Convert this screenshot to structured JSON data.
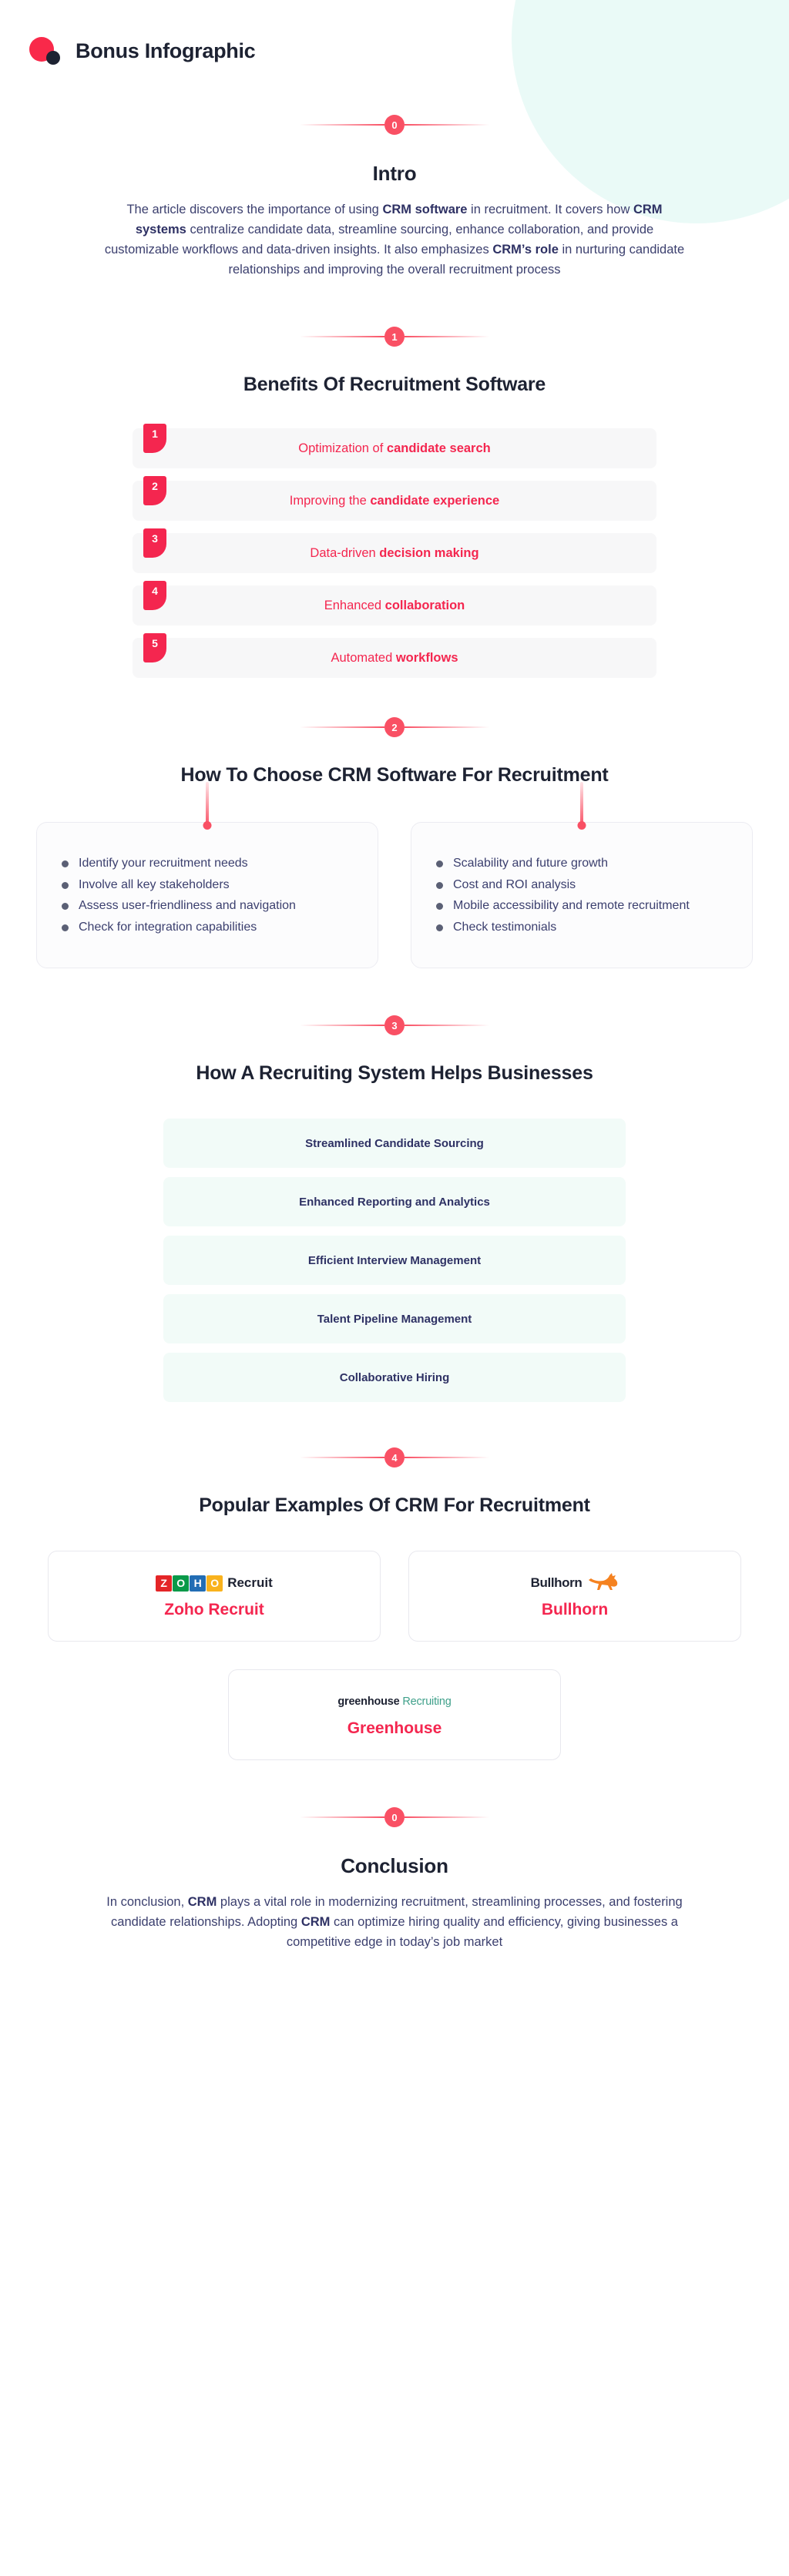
{
  "header": {
    "title": "Bonus Infographic",
    "logo_primary_color": "#f9294a",
    "logo_secondary_color": "#1d2232"
  },
  "theme": {
    "accent_red": "#f4264f",
    "badge_red": "#f95064",
    "text_navy": "#1d2232",
    "body_indigo": "#3b3f6e",
    "mint_bg": "#f2fbf8",
    "gray_row_bg": "#f7f7f8"
  },
  "sections": {
    "intro": {
      "badge": "0",
      "title": "Intro",
      "paragraph_parts": [
        {
          "t": "The article discovers the importance of using ",
          "b": false
        },
        {
          "t": "CRM software",
          "b": true
        },
        {
          "t": " in recruitment. It covers how ",
          "b": false
        },
        {
          "t": "CRM systems",
          "b": true
        },
        {
          "t": " centralize candidate data, streamline sourcing, enhance collaboration, and provide customizable workflows and data-driven insights. It also emphasizes ",
          "b": false
        },
        {
          "t": "CRM’s role",
          "b": true
        },
        {
          "t": " in nurturing candidate relationships and improving the overall recruitment process",
          "b": false
        }
      ]
    },
    "benefits": {
      "badge": "1",
      "title": "Benefits Of Recruitment Software",
      "items": [
        {
          "num": "1",
          "plain": "Optimization of ",
          "bold": "candidate search"
        },
        {
          "num": "2",
          "plain": "Improving the ",
          "bold": "candidate experience"
        },
        {
          "num": "3",
          "plain": "Data-driven ",
          "bold": "decision making"
        },
        {
          "num": "4",
          "plain": "Enhanced ",
          "bold": "collaboration"
        },
        {
          "num": "5",
          "plain": "Automated ",
          "bold": "workflows"
        }
      ]
    },
    "choose": {
      "badge": "2",
      "title": "How To Choose CRM Software For Recruitment",
      "left_items": [
        "Identify your recruitment needs",
        "Involve all key stakeholders",
        "Assess user-friendliness and navigation",
        "Check for integration capabilities"
      ],
      "right_items": [
        "Scalability and future growth",
        "Cost and ROI analysis",
        "Mobile accessibility and remote recruitment",
        "Check testimonials"
      ]
    },
    "helps": {
      "badge": "3",
      "title": "How A Recruiting System Helps Businesses",
      "items": [
        "Streamlined Candidate Sourcing",
        "Enhanced Reporting and Analytics",
        "Efficient Interview Management",
        "Talent Pipeline Management",
        "Collaborative Hiring"
      ]
    },
    "examples": {
      "badge": "4",
      "title": "Popular Examples Of CRM For Recruitment",
      "cards": [
        {
          "name": "Zoho Recruit",
          "logo_word": "Recruit",
          "logo_tiles": [
            "Z",
            "O",
            "H",
            "O"
          ]
        },
        {
          "name": "Bullhorn",
          "logo_word": "Bullhorn"
        },
        {
          "name": "Greenhouse",
          "logo_word": "greenhouse",
          "logo_word2": "Recruiting"
        }
      ]
    },
    "conclusion": {
      "badge": "0",
      "title": "Conclusion",
      "paragraph_parts": [
        {
          "t": "In conclusion, ",
          "b": false
        },
        {
          "t": "CRM",
          "b": true
        },
        {
          "t": " plays a vital role in modernizing recruitment, streamlining processes, and fostering candidate relationships. Adopting ",
          "b": false
        },
        {
          "t": "CRM",
          "b": true
        },
        {
          "t": " can optimize hiring quality and efficiency, giving businesses a competitive edge in today’s job market",
          "b": false
        }
      ]
    }
  }
}
